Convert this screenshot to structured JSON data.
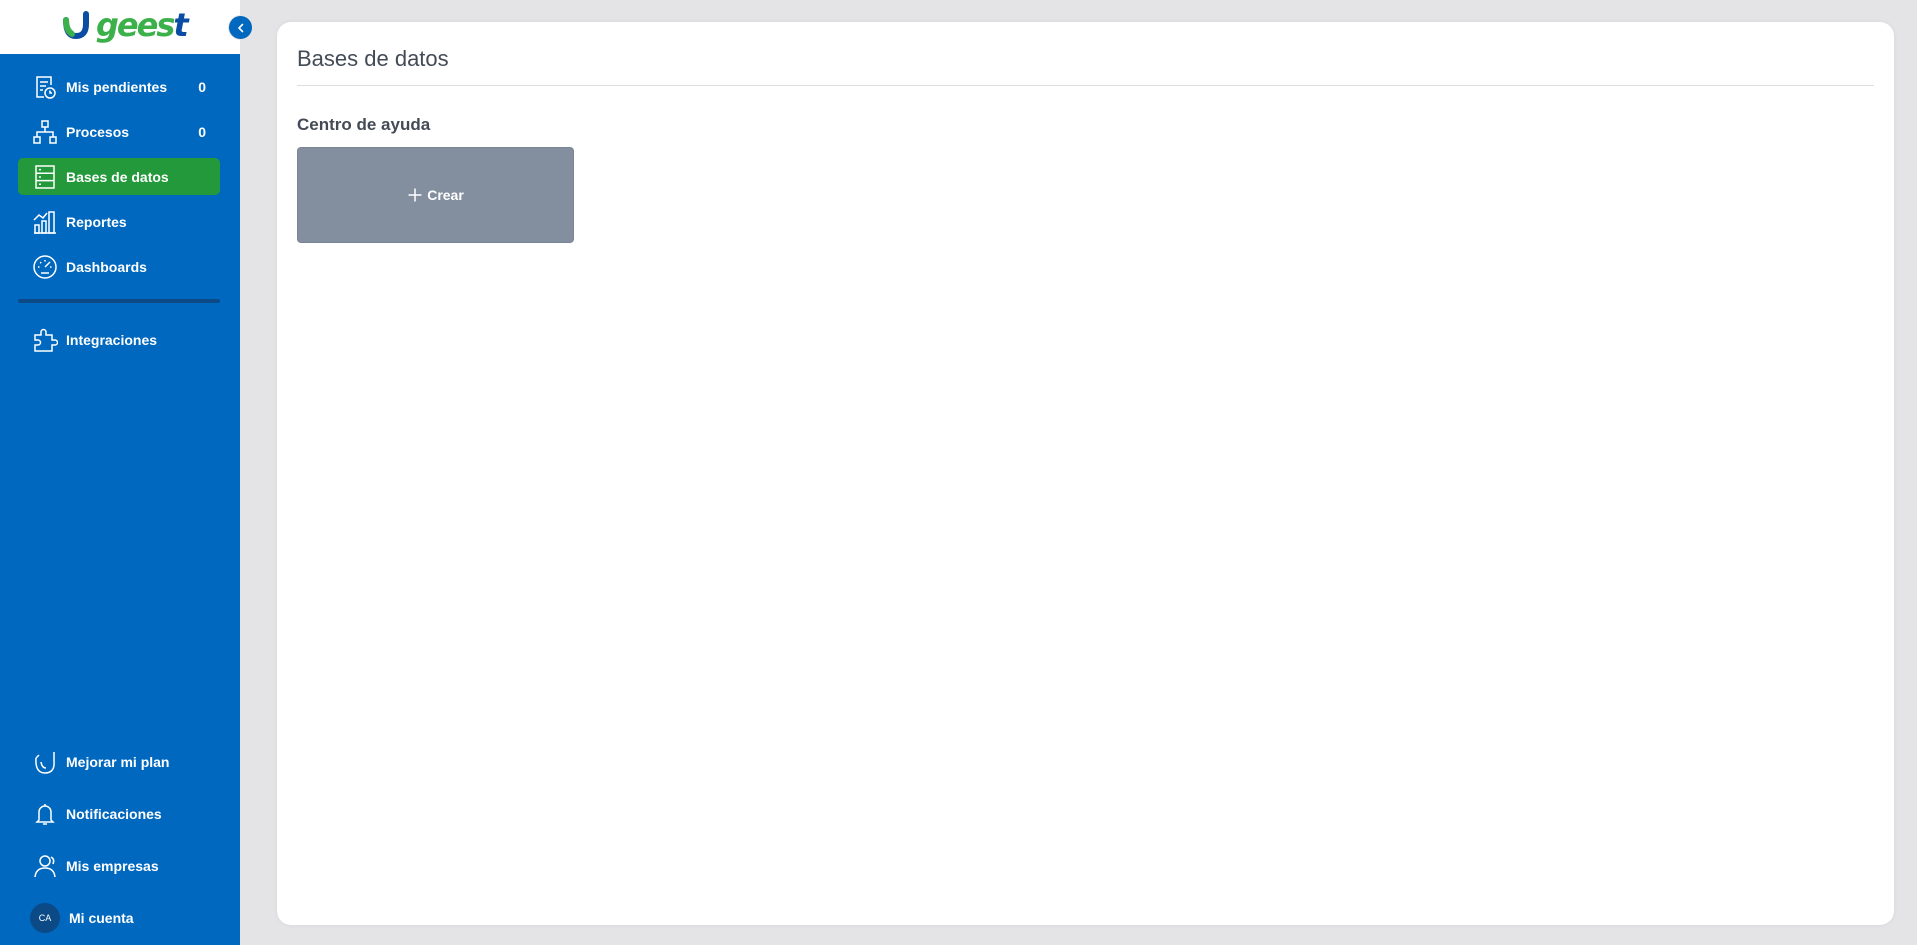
{
  "app": {
    "logo_text": "geest",
    "brand_colors": {
      "sidebar": "#0068be",
      "active": "#24993b",
      "logo_green": "#3cb04a",
      "logo_blue": "#0b4da2"
    }
  },
  "sidebar": {
    "collapse_icon": "chevron-left-icon",
    "items": [
      {
        "label": "Mis pendientes",
        "count": "0",
        "icon": "pending-tasks-icon"
      },
      {
        "label": "Procesos",
        "count": "0",
        "icon": "process-flow-icon"
      },
      {
        "label": "Bases de datos",
        "count": "",
        "icon": "database-icon",
        "active": true
      },
      {
        "label": "Reportes",
        "count": "",
        "icon": "reports-chart-icon"
      },
      {
        "label": "Dashboards",
        "count": "",
        "icon": "gauge-icon"
      },
      {
        "label": "Integraciones",
        "count": "",
        "icon": "puzzle-icon"
      }
    ],
    "bottom_items": [
      {
        "label": "Mejorar mi plan",
        "icon": "upgrade-plan-icon"
      },
      {
        "label": "Notificaciones",
        "icon": "bell-icon"
      },
      {
        "label": "Mis empresas",
        "icon": "users-icon"
      },
      {
        "label": "Mi cuenta",
        "avatar_initials": "CA"
      }
    ]
  },
  "main": {
    "title": "Bases de datos",
    "section_title": "Centro de ayuda",
    "create_button": {
      "label": "Crear",
      "icon": "plus-icon",
      "color": "#838f9f"
    }
  }
}
